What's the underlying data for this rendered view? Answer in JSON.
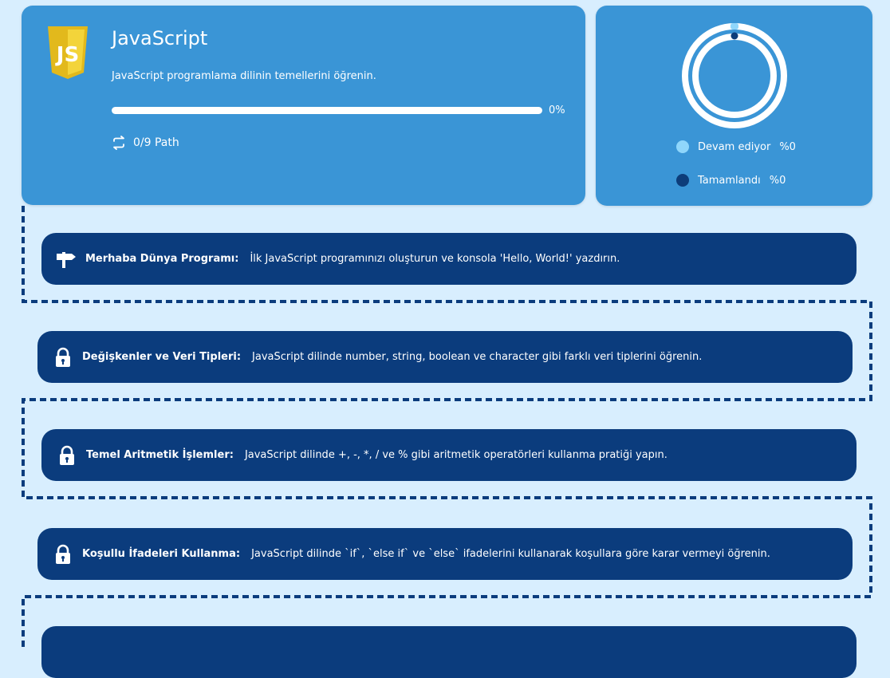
{
  "course": {
    "title": "JavaScript",
    "logo_text": "JS",
    "description": "JavaScript programlama dilinin temellerini öğrenin.",
    "progress_percent": 0,
    "progress_label": "0%",
    "path_label": "0/9 Path",
    "path_icon": "repeat-arrows-icon"
  },
  "stats": {
    "donut": {
      "ongoing_percent": 0,
      "completed_percent": 0
    },
    "legend": [
      {
        "label": "Devam ediyor",
        "value": "%0",
        "color": "#8fd6fb"
      },
      {
        "label": "Tamamlandı",
        "value": "%0",
        "color": "#0d3d7a"
      }
    ]
  },
  "steps": [
    {
      "icon": "signpost-icon",
      "title": "Merhaba Dünya Programı:",
      "description": "İlk JavaScript programınızı oluşturun ve konsola 'Hello, World!' yazdırın."
    },
    {
      "icon": "lock-icon",
      "title": "Değişkenler ve Veri Tipleri:",
      "description": "JavaScript dilinde number, string, boolean ve character gibi farklı veri tiplerini öğrenin."
    },
    {
      "icon": "lock-icon",
      "title": "Temel Aritmetik İşlemler:",
      "description": "JavaScript dilinde +, -, *, / ve % gibi aritmetik operatörleri kullanma pratiği yapın."
    },
    {
      "icon": "lock-icon",
      "title": "Koşullu İfadeleri Kullanma:",
      "description": "JavaScript dilinde `if`, `else if` ve `else` ifadelerini kullanarak koşullara göre karar vermeyi öğrenin."
    }
  ],
  "colors": {
    "page_bg": "#d8eefe",
    "card_bg": "#3a95d6",
    "step_bg": "#0b3c7d",
    "path_line": "#0b3c7d",
    "js_logo": "#f0d12b"
  }
}
